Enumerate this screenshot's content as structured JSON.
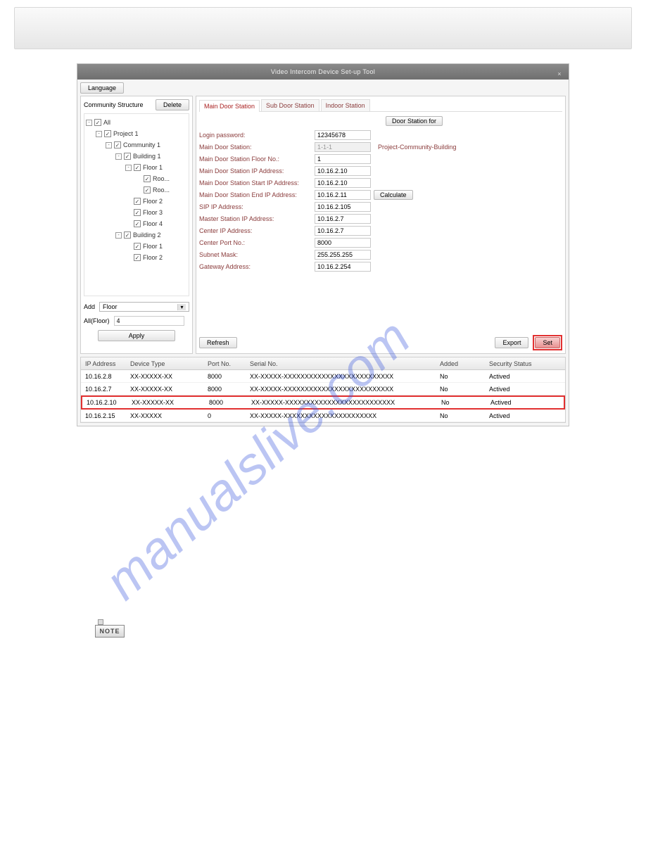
{
  "window": {
    "title": "Video Intercom Device Set-up Tool",
    "language_btn": "Language"
  },
  "left": {
    "header": "Community Structure",
    "delete_btn": "Delete",
    "tree": [
      {
        "lvl": 0,
        "tog": "-",
        "chk": true,
        "label": "All"
      },
      {
        "lvl": 1,
        "tog": "-",
        "chk": true,
        "label": "Project 1"
      },
      {
        "lvl": 2,
        "tog": "-",
        "chk": true,
        "label": "Community 1"
      },
      {
        "lvl": 3,
        "tog": "-",
        "chk": true,
        "label": "Building 1"
      },
      {
        "lvl": 4,
        "tog": "-",
        "chk": true,
        "label": "Floor 1"
      },
      {
        "lvl": 5,
        "tog": "",
        "chk": true,
        "label": "Roo..."
      },
      {
        "lvl": 5,
        "tog": "",
        "chk": true,
        "label": "Roo..."
      },
      {
        "lvl": 4,
        "tog": "",
        "chk": true,
        "label": "Floor 2"
      },
      {
        "lvl": 4,
        "tog": "",
        "chk": true,
        "label": "Floor 3"
      },
      {
        "lvl": 4,
        "tog": "",
        "chk": true,
        "label": "Floor 4"
      },
      {
        "lvl": 3,
        "tog": "-",
        "chk": true,
        "label": "Building 2"
      },
      {
        "lvl": 4,
        "tog": "",
        "chk": true,
        "label": "Floor 1"
      },
      {
        "lvl": 4,
        "tog": "",
        "chk": true,
        "label": "Floor 2"
      }
    ],
    "add_label": "Add",
    "add_value": "Floor",
    "count_label": "All(Floor)",
    "count_value": "4",
    "apply_btn": "Apply"
  },
  "tabs": [
    "Main Door Station",
    "Sub Door Station",
    "Indoor Station"
  ],
  "right": {
    "door_station_btn": "Door Station for",
    "calculate_btn": "Calculate",
    "refresh_btn": "Refresh",
    "export_btn": "Export",
    "set_btn": "Set",
    "rows": [
      {
        "label": "Login password:",
        "val": "12345678",
        "extra": ""
      },
      {
        "label": "Main Door Station:",
        "val": "1-1-1",
        "ro": true,
        "extra": "Project-Community-Building"
      },
      {
        "label": "Main Door Station Floor No.:",
        "val": "1",
        "extra": ""
      },
      {
        "label": "Main Door Station IP Address:",
        "val": "10.16.2.10",
        "extra": ""
      },
      {
        "label": "Main Door Station Start IP Address:",
        "val": "10.16.2.10",
        "extra": ""
      },
      {
        "label": "Main Door Station End IP Address:",
        "val": "10.16.2.11",
        "extra": "calc"
      },
      {
        "label": "SIP IP Address:",
        "val": "10.16.2.105",
        "extra": ""
      },
      {
        "label": "Master Station IP Address:",
        "val": "10.16.2.7",
        "extra": ""
      },
      {
        "label": "Center IP Address:",
        "val": "10.16.2.7",
        "extra": ""
      },
      {
        "label": "Center Port No.:",
        "val": "8000",
        "extra": ""
      },
      {
        "label": "Subnet Mask:",
        "val": "255.255.255",
        "extra": ""
      },
      {
        "label": "Gateway Address:",
        "val": "10.16.2.254",
        "extra": ""
      }
    ]
  },
  "grid": {
    "headers": [
      "IP Address",
      "Device Type",
      "Port No.",
      "Serial No.",
      "Added",
      "Security Status"
    ],
    "rows": [
      {
        "ip": "10.16.2.8",
        "type": "XX-XXXXX-XX",
        "port": "8000",
        "serial": "XX-XXXXX-XXXXXXXXXXXXXXXXXXXXXXXXXX",
        "added": "No",
        "status": "Actived",
        "sel": false
      },
      {
        "ip": "10.16.2.7",
        "type": "XX-XXXXX-XX",
        "port": "8000",
        "serial": "XX-XXXXX-XXXXXXXXXXXXXXXXXXXXXXXXXX",
        "added": "No",
        "status": "Actived",
        "sel": false
      },
      {
        "ip": "10.16.2.10",
        "type": "XX-XXXXX-XX",
        "port": "8000",
        "serial": "XX-XXXXX-XXXXXXXXXXXXXXXXXXXXXXXXXX",
        "added": "No",
        "status": "Actived",
        "sel": true
      },
      {
        "ip": "10.16.2.15",
        "type": "XX-XXXXX",
        "port": "0",
        "serial": "XX-XXXXX-XXXXXXXXXXXXXXXXXXXXXX",
        "added": "No",
        "status": "Actived",
        "sel": false
      }
    ]
  },
  "watermark": "manualslive.com",
  "note": "NOTE"
}
